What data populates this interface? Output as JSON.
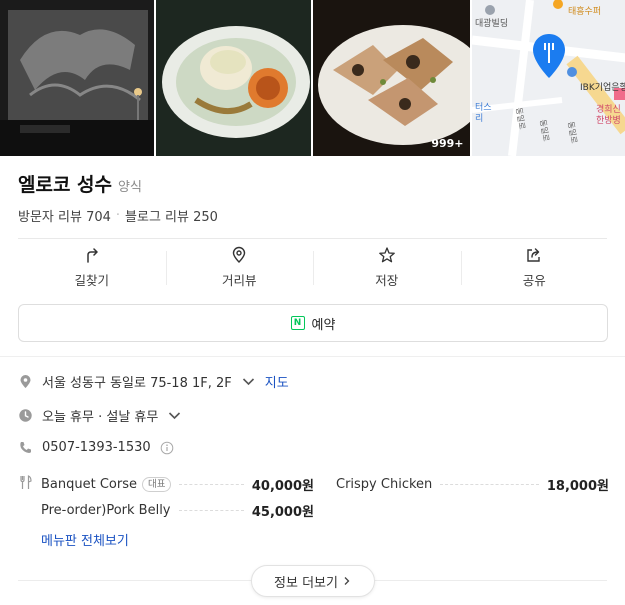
{
  "photos": {
    "count_badge": "999+",
    "map_labels": {
      "shop_top": "태흥수퍼",
      "building": "대광빌딩",
      "bank": "IBK기업은행",
      "partial_left": "터스\n리",
      "road_a": "동일로",
      "road_b": "동일로",
      "road_c": "동일로",
      "hospital": "경희신\n한방병"
    }
  },
  "place": {
    "name": "엘로코 성수",
    "category": "양식",
    "visitor_reviews": "방문자 리뷰 704",
    "blog_reviews": "블로그 리뷰 250"
  },
  "actions": [
    {
      "label": "길찾기",
      "icon": "directions-icon"
    },
    {
      "label": "거리뷰",
      "icon": "pin-outline-icon"
    },
    {
      "label": "저장",
      "icon": "star-icon"
    },
    {
      "label": "공유",
      "icon": "share-icon"
    }
  ],
  "reserve": {
    "label": "예약",
    "icon_letter": "N"
  },
  "info": {
    "address": "서울 성동구 동일로 75-18 1F, 2F",
    "map_link": "지도",
    "hours": "오늘 휴무 · 설날 휴무",
    "phone": "0507-1393-1530"
  },
  "menu": {
    "items": [
      {
        "name": "Banquet Corse",
        "badge": "대표",
        "price": "40,000원"
      },
      {
        "name": "Crispy Chicken",
        "badge": "",
        "price": "18,000원"
      },
      {
        "name": "Pre-order)Pork Belly",
        "badge": "",
        "price": "45,000원"
      }
    ],
    "view_all": "메뉴판 전체보기"
  },
  "more_button": "정보 더보기",
  "colors": {
    "accent_link": "#1a52c2",
    "naver_green": "#03c75a",
    "map_pin": "#1b7cf0"
  }
}
